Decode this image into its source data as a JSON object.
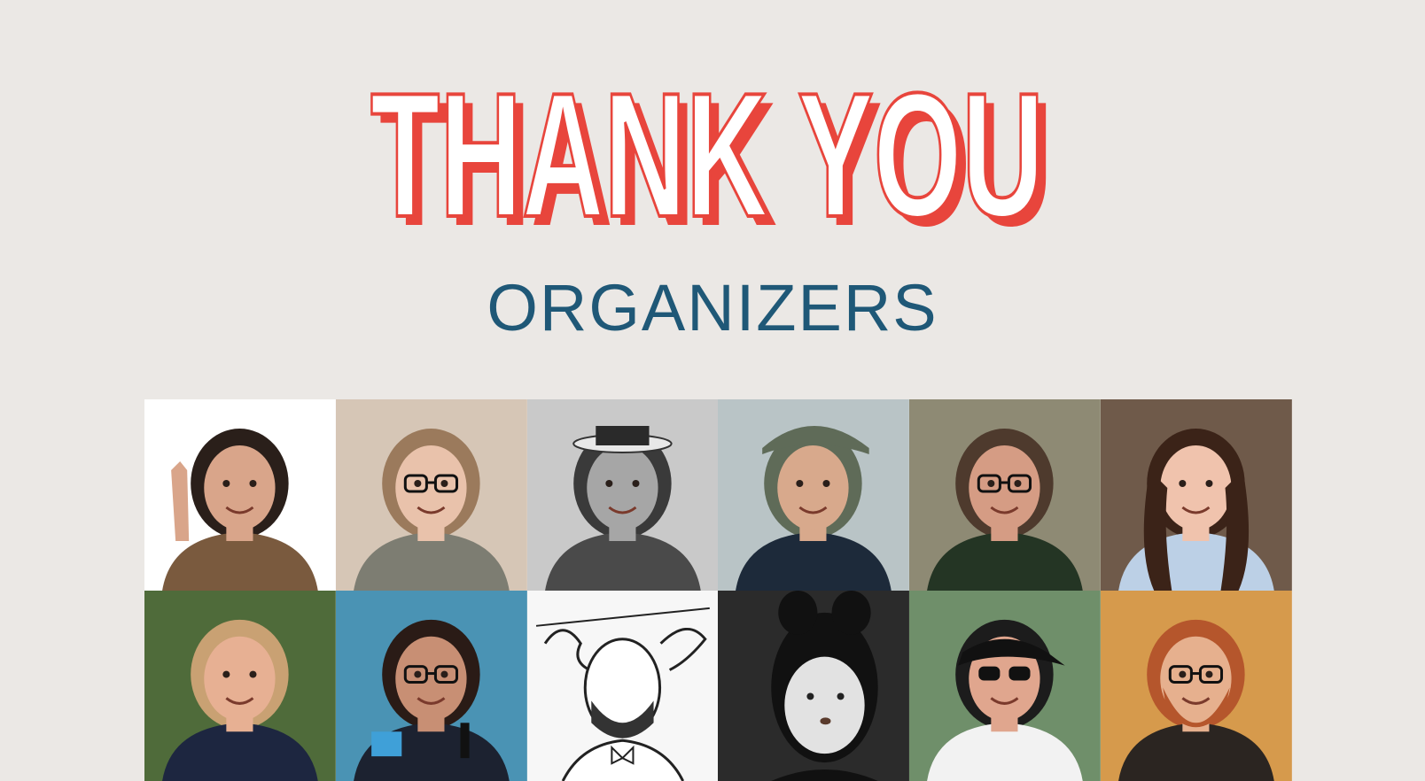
{
  "slide": {
    "title": "THANK YOU",
    "subtitle": "ORGANIZERS"
  },
  "colors": {
    "background": "#ebe8e5",
    "title_red": "#e8453c",
    "subtitle_blue": "#1f5877"
  },
  "organizer_photos": [
    {
      "id": "organizer-photo-1",
      "bg": "#ffffff",
      "skin": "#d9a58a",
      "hair": "#2a1f1a",
      "shirt": "#7a5a3e",
      "style": "wave"
    },
    {
      "id": "organizer-photo-2",
      "bg": "#d6c6b6",
      "skin": "#e9c2ab",
      "hair": "#9b7a5c",
      "shirt": "#7d7d72",
      "style": "glasses"
    },
    {
      "id": "organizer-photo-3",
      "bg": "#c9c9c9",
      "skin": "#a6a6a6",
      "hair": "#3a3a3a",
      "shirt": "#4a4a4a",
      "style": "hat-gray"
    },
    {
      "id": "organizer-photo-4",
      "bg": "#b9c4c6",
      "skin": "#d8a98c",
      "hair": "#5f6b58",
      "shirt": "#1d2a3a",
      "style": "flatcap"
    },
    {
      "id": "organizer-photo-5",
      "bg": "#8e8a74",
      "skin": "#d59c84",
      "hair": "#4e3a2d",
      "shirt": "#243524",
      "style": "office"
    },
    {
      "id": "organizer-photo-6",
      "bg": "#6f5a4a",
      "skin": "#f0c3ad",
      "hair": "#3b2318",
      "shirt": "#bcd0e6",
      "style": "longhair"
    },
    {
      "id": "organizer-photo-7",
      "bg": "#4f6b3a",
      "skin": "#e7b093",
      "hair": "#c9a173",
      "shirt": "#1d2640",
      "style": "outdoor"
    },
    {
      "id": "organizer-photo-8",
      "bg": "#4a93b4",
      "skin": "#c88f74",
      "hair": "#2a1b16",
      "shirt": "#1c2230",
      "style": "mic"
    },
    {
      "id": "organizer-photo-9",
      "bg": "#f4f4f4",
      "skin": "#ffffff",
      "hair": "#222222",
      "shirt": "#ffffff",
      "style": "sketch"
    },
    {
      "id": "organizer-photo-10",
      "bg": "#2e2e2e",
      "skin": "#e2e2e2",
      "hair": "#121212",
      "shirt": "#1c1c1c",
      "style": "bw-bow"
    },
    {
      "id": "organizer-photo-11",
      "bg": "#6f8f6a",
      "skin": "#e0a68e",
      "hair": "#1c1c1c",
      "shirt": "#f2f2f2",
      "style": "visor"
    },
    {
      "id": "organizer-photo-12",
      "bg": "#d69a4c",
      "skin": "#e6b08e",
      "hair": "#b5562c",
      "shirt": "#2b2521",
      "style": "beard"
    }
  ]
}
